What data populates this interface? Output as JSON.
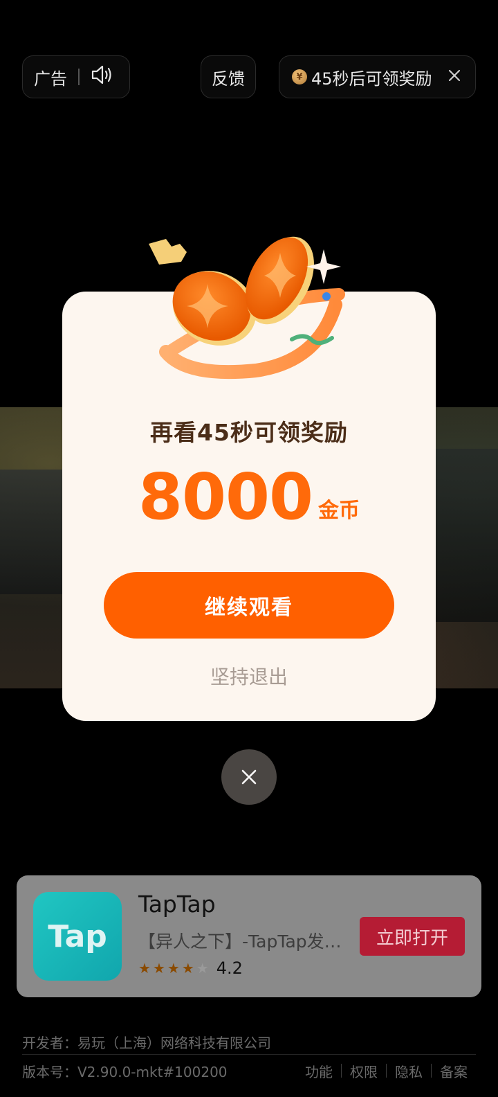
{
  "topbar": {
    "ad_label": "广告",
    "feedback_label": "反馈",
    "reward_countdown": "45秒后可领奖励",
    "coin_symbol": "¥"
  },
  "modal": {
    "title": "再看45秒可领奖励",
    "amount": "8000",
    "amount_unit": "金币",
    "continue_label": "继续观看",
    "quit_label": "坚持退出"
  },
  "app_card": {
    "icon_text": "Tap",
    "name": "TapTap",
    "description": "【异人之下】-TapTap发…",
    "rating": "4.2",
    "stars_filled": 4,
    "stars_total": 5,
    "open_label": "立即打开"
  },
  "footer": {
    "developer": "开发者：易玩（上海）网络科技有限公司",
    "version": "版本号：V2.90.0-mkt#100200",
    "links": [
      "功能",
      "权限",
      "隐私",
      "备案"
    ]
  },
  "colors": {
    "accent": "#ff6000",
    "open_button": "#b51c34"
  }
}
